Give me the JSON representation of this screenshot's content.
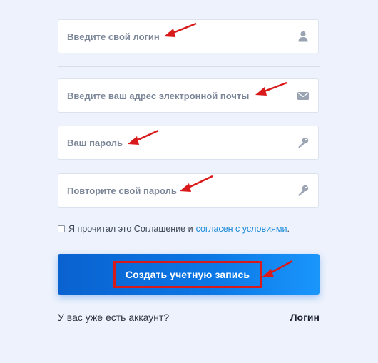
{
  "form": {
    "login": {
      "placeholder": "Введите свой логин",
      "icon": "user-icon"
    },
    "email": {
      "placeholder": "Введите ваш адрес электронной почты",
      "icon": "envelope-icon"
    },
    "password": {
      "placeholder": "Ваш пароль",
      "icon": "key-icon"
    },
    "password_repeat": {
      "placeholder": "Повторите свой пароль",
      "icon": "key-icon"
    }
  },
  "agreement": {
    "text": "Я прочитал это Соглашение и",
    "link": "согласен с условиями",
    "tail": "."
  },
  "submit": {
    "label": "Создать учетную запись"
  },
  "footer": {
    "have_account": "У вас уже есть аккаунт?",
    "login_link": "Логин"
  },
  "colors": {
    "page_bg": "#edf2fc",
    "button_from": "#0a62cf",
    "button_to": "#1a96fb",
    "annotation_red": "#d91a1a",
    "link_blue": "#1a8ad8"
  }
}
